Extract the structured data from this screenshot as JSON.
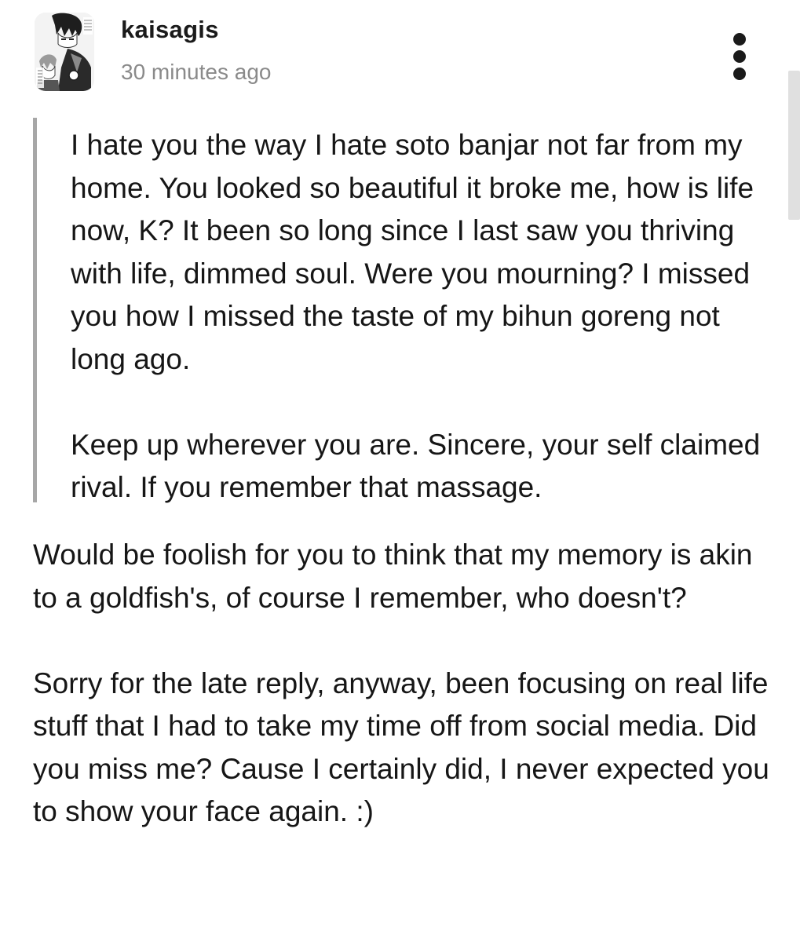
{
  "post": {
    "author": {
      "username": "kaisagis",
      "avatar_icon": "avatar-image"
    },
    "timestamp": "30 minutes ago",
    "menu_icon": "more-vertical-icon",
    "quoted_message": {
      "paragraphs": [
        "I hate you the way I hate soto banjar not far from my home. You looked so beautiful it broke me, how is life now, K? It been so long since I last saw you thriving with life, dimmed soul. Were you mourning? I missed you how I missed the taste of my bihun goreng not long ago.",
        "Keep up wherever you are. Sincere, your self claimed rival. If you remember that massage."
      ]
    },
    "reply": {
      "paragraphs": [
        "Would be foolish for you to think that my memory is akin to a goldfish's, of course I remember, who doesn't?",
        "Sorry for the late reply, anyway, been focusing on real life stuff that I had to take my time off from social media. Did you miss me? Cause I certainly did, I never expected you to show your face again. :)"
      ]
    }
  },
  "colors": {
    "text": "#161616",
    "muted": "#8a8a8a",
    "quote_bar": "#a7a7a7",
    "background": "#ffffff"
  }
}
